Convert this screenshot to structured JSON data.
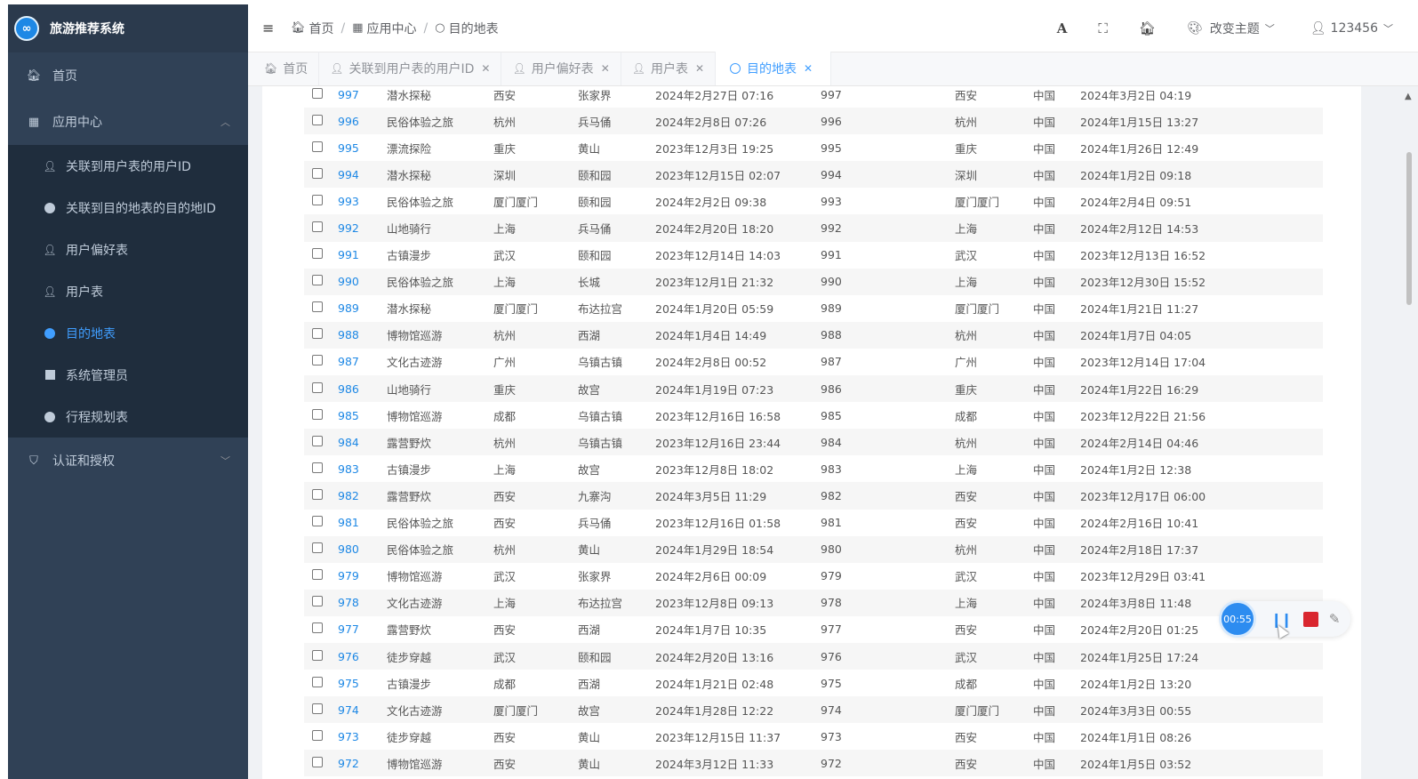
{
  "app": {
    "title": "旅游推荐系统",
    "logo_glyph": "∞"
  },
  "sidebar": {
    "home": "首页",
    "app_center": "应用中心",
    "sub_items": [
      {
        "label": "关联到用户表的用户ID",
        "icon": "user-icon"
      },
      {
        "label": "关联到目的地表的目的地ID",
        "icon": "dot-icon"
      },
      {
        "label": "用户偏好表",
        "icon": "user-icon"
      },
      {
        "label": "用户表",
        "icon": "user-icon"
      },
      {
        "label": "目的地表",
        "icon": "dot-icon",
        "active": true
      },
      {
        "label": "系统管理员",
        "icon": "square-icon"
      },
      {
        "label": "行程规划表",
        "icon": "dot-icon"
      }
    ],
    "auth": "认证和授权"
  },
  "breadcrumb": {
    "home": "首页",
    "app_center": "应用中心",
    "current": "目的地表"
  },
  "topbar": {
    "theme_label": "改变主题",
    "user_name": "123456"
  },
  "tabs": [
    {
      "label": "首页",
      "closable": false
    },
    {
      "label": "关联到用户表的用户ID",
      "closable": true
    },
    {
      "label": "用户偏好表",
      "closable": true
    },
    {
      "label": "用户表",
      "closable": true
    },
    {
      "label": "目的地表",
      "closable": true,
      "active": true
    }
  ],
  "table": {
    "rows": [
      [
        "997",
        "潜水探秘",
        "西安",
        "张家界",
        "2024年2月27日 07:16",
        "997",
        "西安",
        "中国",
        "2024年3月2日 04:19"
      ],
      [
        "996",
        "民俗体验之旅",
        "杭州",
        "兵马俑",
        "2024年2月8日 07:26",
        "996",
        "杭州",
        "中国",
        "2024年1月15日 13:27"
      ],
      [
        "995",
        "漂流探险",
        "重庆",
        "黄山",
        "2023年12月3日 19:25",
        "995",
        "重庆",
        "中国",
        "2024年1月26日 12:49"
      ],
      [
        "994",
        "潜水探秘",
        "深圳",
        "颐和园",
        "2023年12月15日 02:07",
        "994",
        "深圳",
        "中国",
        "2024年1月2日 09:18"
      ],
      [
        "993",
        "民俗体验之旅",
        "厦门厦门",
        "颐和园",
        "2024年2月2日 09:38",
        "993",
        "厦门厦门",
        "中国",
        "2024年2月4日 09:51"
      ],
      [
        "992",
        "山地骑行",
        "上海",
        "兵马俑",
        "2024年2月20日 18:20",
        "992",
        "上海",
        "中国",
        "2024年2月12日 14:53"
      ],
      [
        "991",
        "古镇漫步",
        "武汉",
        "颐和园",
        "2023年12月14日 14:03",
        "991",
        "武汉",
        "中国",
        "2023年12月13日 16:52"
      ],
      [
        "990",
        "民俗体验之旅",
        "上海",
        "长城",
        "2023年12月1日 21:32",
        "990",
        "上海",
        "中国",
        "2023年12月30日 15:52"
      ],
      [
        "989",
        "潜水探秘",
        "厦门厦门",
        "布达拉宫",
        "2024年1月20日 05:59",
        "989",
        "厦门厦门",
        "中国",
        "2024年1月21日 11:27"
      ],
      [
        "988",
        "博物馆巡游",
        "杭州",
        "西湖",
        "2024年1月4日 14:49",
        "988",
        "杭州",
        "中国",
        "2024年1月7日 04:05"
      ],
      [
        "987",
        "文化古迹游",
        "广州",
        "乌镇古镇",
        "2024年2月8日 00:52",
        "987",
        "广州",
        "中国",
        "2023年12月14日 17:04"
      ],
      [
        "986",
        "山地骑行",
        "重庆",
        "故宫",
        "2024年1月19日 07:23",
        "986",
        "重庆",
        "中国",
        "2024年1月22日 16:29"
      ],
      [
        "985",
        "博物馆巡游",
        "成都",
        "乌镇古镇",
        "2023年12月16日 16:58",
        "985",
        "成都",
        "中国",
        "2023年12月22日 21:56"
      ],
      [
        "984",
        "露营野炊",
        "杭州",
        "乌镇古镇",
        "2023年12月16日 23:44",
        "984",
        "杭州",
        "中国",
        "2024年2月14日 04:46"
      ],
      [
        "983",
        "古镇漫步",
        "上海",
        "故宫",
        "2023年12月8日 18:02",
        "983",
        "上海",
        "中国",
        "2024年1月2日 12:38"
      ],
      [
        "982",
        "露营野炊",
        "西安",
        "九寨沟",
        "2024年3月5日 11:29",
        "982",
        "西安",
        "中国",
        "2023年12月17日 06:00"
      ],
      [
        "981",
        "民俗体验之旅",
        "西安",
        "兵马俑",
        "2023年12月16日 01:58",
        "981",
        "西安",
        "中国",
        "2024年2月16日 10:41"
      ],
      [
        "980",
        "民俗体验之旅",
        "杭州",
        "黄山",
        "2024年1月29日 18:54",
        "980",
        "杭州",
        "中国",
        "2024年2月18日 17:37"
      ],
      [
        "979",
        "博物馆巡游",
        "武汉",
        "张家界",
        "2024年2月6日 00:09",
        "979",
        "武汉",
        "中国",
        "2023年12月29日 03:41"
      ],
      [
        "978",
        "文化古迹游",
        "上海",
        "布达拉宫",
        "2023年12月8日 09:13",
        "978",
        "上海",
        "中国",
        "2024年3月8日 11:48"
      ],
      [
        "977",
        "露营野炊",
        "西安",
        "西湖",
        "2024年1月7日 10:35",
        "977",
        "西安",
        "中国",
        "2024年2月20日 01:25"
      ],
      [
        "976",
        "徒步穿越",
        "武汉",
        "颐和园",
        "2024年2月20日 13:16",
        "976",
        "武汉",
        "中国",
        "2024年1月25日 17:24"
      ],
      [
        "975",
        "古镇漫步",
        "成都",
        "西湖",
        "2024年1月21日 02:48",
        "975",
        "成都",
        "中国",
        "2024年1月2日 13:20"
      ],
      [
        "974",
        "文化古迹游",
        "厦门厦门",
        "故宫",
        "2024年1月28日 12:22",
        "974",
        "厦门厦门",
        "中国",
        "2024年3月3日 00:55"
      ],
      [
        "973",
        "徒步穿越",
        "西安",
        "黄山",
        "2023年12月15日 11:37",
        "973",
        "西安",
        "中国",
        "2024年1月1日 08:26"
      ],
      [
        "972",
        "博物馆巡游",
        "西安",
        "黄山",
        "2024年3月12日 11:33",
        "972",
        "西安",
        "中国",
        "2024年1月5日 03:52"
      ]
    ]
  },
  "recorder": {
    "time": "00:55"
  },
  "colors": {
    "sidebar_bg": "#304156",
    "accent": "#409eff",
    "link": "#1e88e5",
    "stop": "#d9262f"
  }
}
